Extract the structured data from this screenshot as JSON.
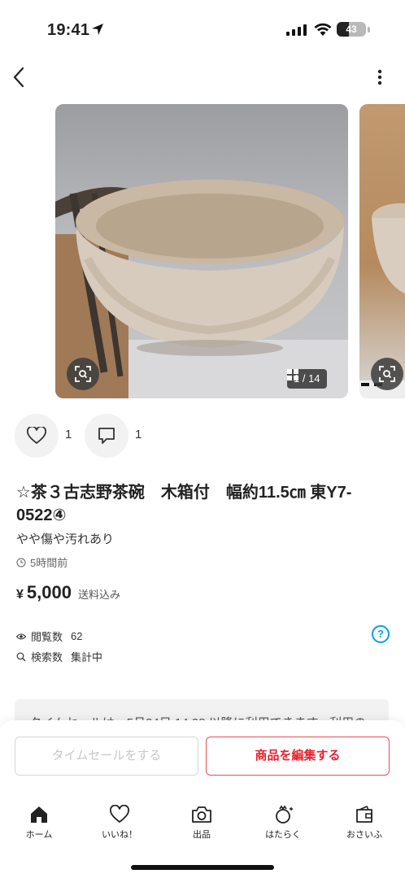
{
  "status_bar": {
    "time": "19:41",
    "battery": "43"
  },
  "gallery": {
    "counter": "1 / 14"
  },
  "actions": {
    "like_count": "1",
    "comment_count": "1"
  },
  "item": {
    "title": "☆茶３古志野茶碗　木箱付　幅約11.5㎝ 東Y7-0522④",
    "condition": "やや傷や汚れあり",
    "posted": "5時間前",
    "price_symbol": "¥",
    "price": "5,000",
    "shipping": "送料込み",
    "views_label": "閲覧数",
    "views": "62",
    "searches_label": "検索数",
    "searches": "集計中"
  },
  "notice": {
    "text": "タイムセールは、5月24日 14:28 以降に利用できます。利用の"
  },
  "buttons": {
    "time_sale": "タイムセールをする",
    "edit": "商品を編集する"
  },
  "tabs": [
    {
      "label": "ホーム",
      "icon": "home-icon"
    },
    {
      "label": "いいね！",
      "icon": "heart-icon"
    },
    {
      "label": "出品",
      "icon": "camera-icon"
    },
    {
      "label": "はたらく",
      "icon": "work-icon"
    },
    {
      "label": "おさいふ",
      "icon": "wallet-icon"
    }
  ],
  "colors": {
    "accent_red": "#e8202f",
    "help_blue": "#0aa0e0"
  }
}
